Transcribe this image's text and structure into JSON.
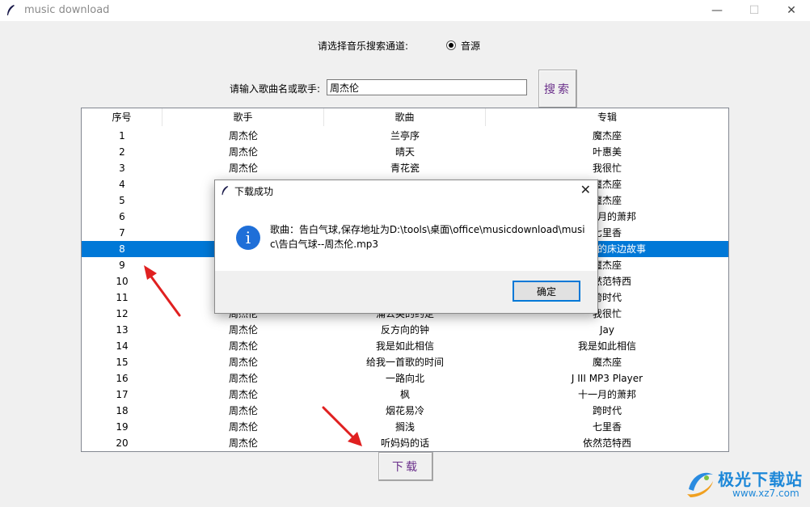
{
  "window": {
    "title": "music download",
    "minimize": "—",
    "maximize": "☐",
    "close": "✕"
  },
  "search": {
    "channel_label": "请选择音乐搜索通道:",
    "channel_option": "音源",
    "input_label": "请输入歌曲名或歌手:",
    "input_value": "周杰伦",
    "search_button": "搜索"
  },
  "table": {
    "headers": [
      "序号",
      "歌手",
      "歌曲",
      "专辑"
    ],
    "rows": [
      [
        "1",
        "周杰伦",
        "兰亭序",
        "魔杰座"
      ],
      [
        "2",
        "周杰伦",
        "晴天",
        "叶惠美"
      ],
      [
        "3",
        "周杰伦",
        "青花瓷",
        "我很忙"
      ],
      [
        "4",
        "",
        "",
        "魔杰座"
      ],
      [
        "5",
        "",
        "",
        "魔杰座"
      ],
      [
        "6",
        "",
        "",
        "十一月的萧邦"
      ],
      [
        "7",
        "",
        "",
        "七里香"
      ],
      [
        "8",
        "",
        "",
        "周杰伦的床边故事"
      ],
      [
        "9",
        "",
        "",
        "魔杰座"
      ],
      [
        "10",
        "",
        "",
        "依然范特西"
      ],
      [
        "11",
        "",
        "",
        "跨时代"
      ],
      [
        "12",
        "周杰伦",
        "蒲公英的约定",
        "我很忙"
      ],
      [
        "13",
        "周杰伦",
        "反方向的钟",
        "Jay"
      ],
      [
        "14",
        "周杰伦",
        "我是如此相信",
        "我是如此相信"
      ],
      [
        "15",
        "周杰伦",
        "给我一首歌的时间",
        "魔杰座"
      ],
      [
        "16",
        "周杰伦",
        "一路向北",
        "J III MP3 Player"
      ],
      [
        "17",
        "周杰伦",
        "枫",
        "十一月的萧邦"
      ],
      [
        "18",
        "周杰伦",
        "烟花易冷",
        "跨时代"
      ],
      [
        "19",
        "周杰伦",
        "搁浅",
        "七里香"
      ],
      [
        "20",
        "周杰伦",
        "听妈妈的话",
        "依然范特西"
      ]
    ],
    "selected_row": "8"
  },
  "download_button": "下载",
  "dialog": {
    "title": "下载成功",
    "message": "歌曲：告白气球,保存地址为D:\\tools\\桌面\\office\\musicdownload\\music\\告白气球--周杰伦.mp3",
    "ok_button": "确定",
    "close": "✕",
    "info_icon": "i"
  },
  "watermark": {
    "name": "极光下载站",
    "url": "www.xz7.com"
  },
  "colors": {
    "selection": "#0078d7",
    "button_text": "#6a2f8a",
    "arrow": "#e02020",
    "info_icon": "#1f6fd8"
  }
}
